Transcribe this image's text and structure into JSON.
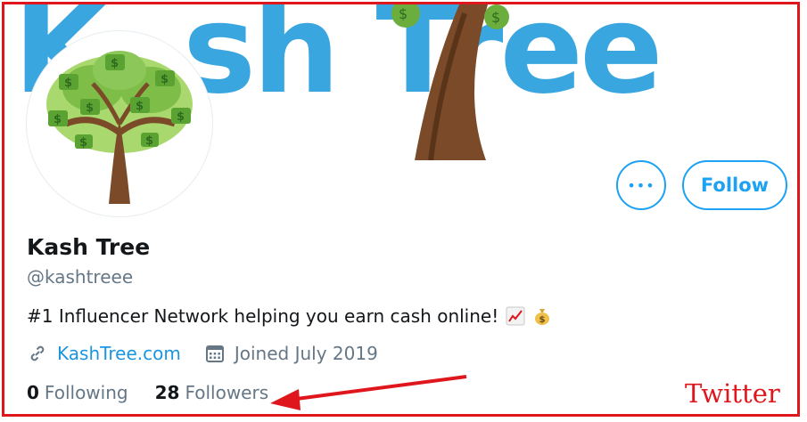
{
  "banner": {
    "left_text": "K",
    "brand_text": "sh Tree"
  },
  "profile": {
    "name": "Kash Tree",
    "handle": "@kashtreee",
    "bio": "#1 Influencer Network helping you earn cash online!",
    "bio_emojis": [
      "chart-increasing-icon",
      "money-bag-icon"
    ],
    "website": "KashTree.com",
    "joined": "Joined July 2019"
  },
  "stats": {
    "following_count": "0",
    "following_label": "Following",
    "followers_count": "28",
    "followers_label": "Followers"
  },
  "actions": {
    "more_label": "•••",
    "follow_label": "Follow"
  },
  "annotation": {
    "label": "Twitter"
  },
  "colors": {
    "accent": "#1da1f2",
    "link": "#1b95e0",
    "banner_blue": "#3aa6df",
    "annotation_red": "#e0161d"
  }
}
